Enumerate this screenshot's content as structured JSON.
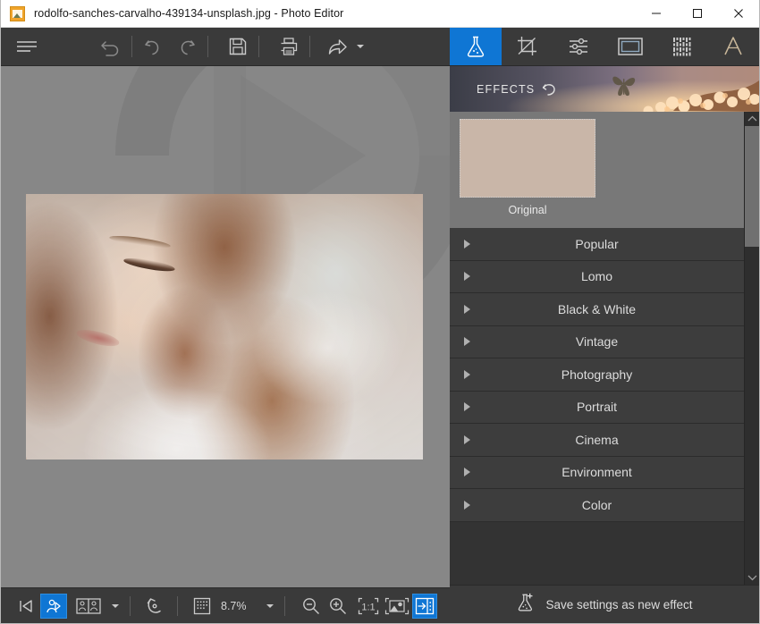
{
  "window": {
    "title": "rodolfo-sanches-carvalho-439134-unsplash.jpg - Photo Editor",
    "app_icon": "photo-app-icon",
    "minimize_label": "Minimize",
    "maximize_label": "Maximize",
    "close_label": "Close"
  },
  "toolbar": {
    "menu_label": "Menu",
    "undo_all_label": "Undo all",
    "undo_label": "Undo",
    "redo_label": "Redo",
    "save_label": "Save",
    "print_label": "Print",
    "share_label": "Share"
  },
  "tabs": [
    {
      "id": "effects",
      "label": "Effects",
      "icon": "flask-icon",
      "active": true
    },
    {
      "id": "crop",
      "label": "Crop",
      "icon": "crop-icon",
      "active": false
    },
    {
      "id": "adjustments",
      "label": "Adjustments",
      "icon": "sliders-icon",
      "active": false
    },
    {
      "id": "frames",
      "label": "Frames",
      "icon": "frame-icon",
      "active": false
    },
    {
      "id": "textures",
      "label": "Textures",
      "icon": "texture-icon",
      "active": false
    },
    {
      "id": "text",
      "label": "Text",
      "icon": "text-a-icon",
      "active": false
    }
  ],
  "effects_panel": {
    "header_title": "EFFECTS",
    "reset_icon": "reset-arrow-icon",
    "original_thumb_label": "Original",
    "categories": [
      {
        "label": "Popular",
        "expanded": false
      },
      {
        "label": "Lomo",
        "expanded": false
      },
      {
        "label": "Black & White",
        "expanded": false
      },
      {
        "label": "Vintage",
        "expanded": false
      },
      {
        "label": "Photography",
        "expanded": false
      },
      {
        "label": "Portrait",
        "expanded": false
      },
      {
        "label": "Cinema",
        "expanded": false
      },
      {
        "label": "Environment",
        "expanded": false
      },
      {
        "label": "Color",
        "expanded": false
      }
    ],
    "save_effect_label": "Save settings as new effect",
    "save_effect_icon": "flask-plus-icon"
  },
  "bottom_bar": {
    "prev_image_label": "Previous image",
    "slideshow_label": "Slideshow",
    "compare_label": "Compare",
    "compare_caret": "▾",
    "rotate_label": "Rotate",
    "zoom_value": "8.7%",
    "zoom_caret": "▾",
    "zoom_out_label": "Zoom out",
    "zoom_in_label": "Zoom in",
    "actual_size_label": "1:1",
    "fit_screen_label": "Fit to screen",
    "toggle_panel_label": "Toggle panel"
  },
  "colors": {
    "accent_blue": "#0f76d4",
    "toolbar_bg": "#3a3a3a",
    "panel_bg": "#333333",
    "row_bg": "#3d3d3d",
    "canvas_bg": "#878787",
    "titlebar_bg": "#ffffff",
    "text_light": "#dcdcdc"
  }
}
